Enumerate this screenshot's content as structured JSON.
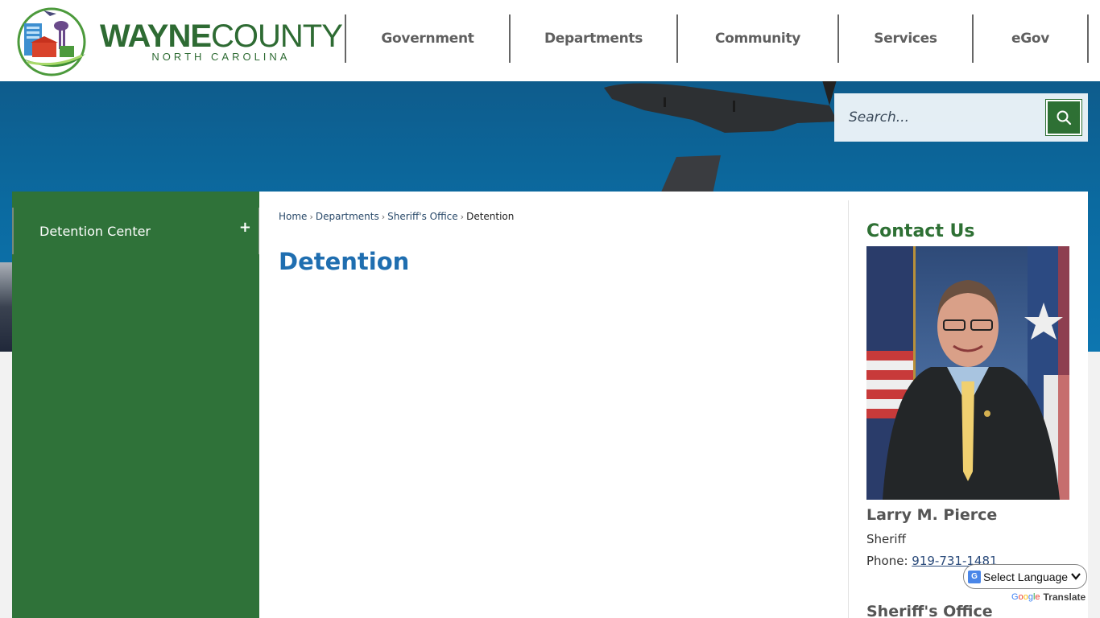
{
  "header": {
    "logo": {
      "title_bold": "WAYNE",
      "title_regular": "COUNTY",
      "subtitle": "NORTH CAROLINA"
    },
    "nav": [
      {
        "label": "Government"
      },
      {
        "label": "Departments"
      },
      {
        "label": "Community"
      },
      {
        "label": "Services"
      },
      {
        "label": "eGov"
      }
    ]
  },
  "search": {
    "placeholder": "Search...",
    "button_icon": "search-icon"
  },
  "sidebar": {
    "items": [
      {
        "label": "Detention Center",
        "toggle": "+"
      }
    ]
  },
  "breadcrumb": [
    {
      "label": "Home"
    },
    {
      "label": "Departments"
    },
    {
      "label": "Sheriff's Office"
    },
    {
      "label": "Detention",
      "current": true
    }
  ],
  "breadcrumb_separator": "›",
  "page": {
    "title": "Detention"
  },
  "contact": {
    "title": "Contact Us",
    "person": {
      "name": "Larry M. Pierce",
      "role": "Sheriff",
      "phone_label": "Phone: ",
      "phone": "919-731-1481"
    },
    "office_title": "Sheriff's Office"
  },
  "translate": {
    "select_label": "Select Language",
    "powered_by_brand": "Google",
    "powered_by_product": "Translate"
  },
  "colors": {
    "brand_green": "#2f7239",
    "title_blue": "#1f6eb0",
    "contact_green": "#2e7034"
  }
}
